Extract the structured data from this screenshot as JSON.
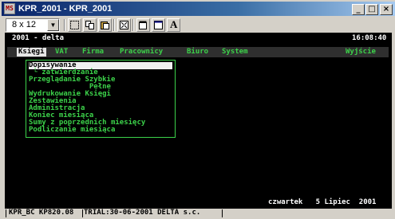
{
  "window": {
    "title": "KPR_2001 - KPR_2001",
    "app_icon_text": "MS",
    "minimize_symbol": "_",
    "maximize_symbol": "□",
    "close_symbol": "×"
  },
  "toolbar": {
    "font_size_value": "8 x 12",
    "font_button_label": "A"
  },
  "console": {
    "header_left": "2001 - delta",
    "header_right": "16:08:40",
    "menu": [
      "Księgi",
      "VAT",
      "Firma",
      "Pracownicy",
      "Biuro",
      "System",
      "Wyjście"
    ],
    "active_menu": "Księgi",
    "dropdown": {
      "items": [
        "Dopisywanie",
        " └ zatwierdzanie",
        "Przeglądanie Szybkie",
        "              Pełne",
        "Wydrukowanie Księgi",
        "Zestawienia",
        "Administracja",
        "Koniec miesiąca",
        "Sumy z poprzednich miesięcy",
        "Podliczanie miesiąca"
      ]
    },
    "date_line": "czwartek   5 Lipiec  2001"
  },
  "status": {
    "left": "KPR_BC KP820.08",
    "right": "TRIAL:30-06-2001 DELTA s.c."
  },
  "colors": {
    "console_bg": "#000000",
    "menu_green": "#3cd24a",
    "title_bar": "#0a246a"
  }
}
